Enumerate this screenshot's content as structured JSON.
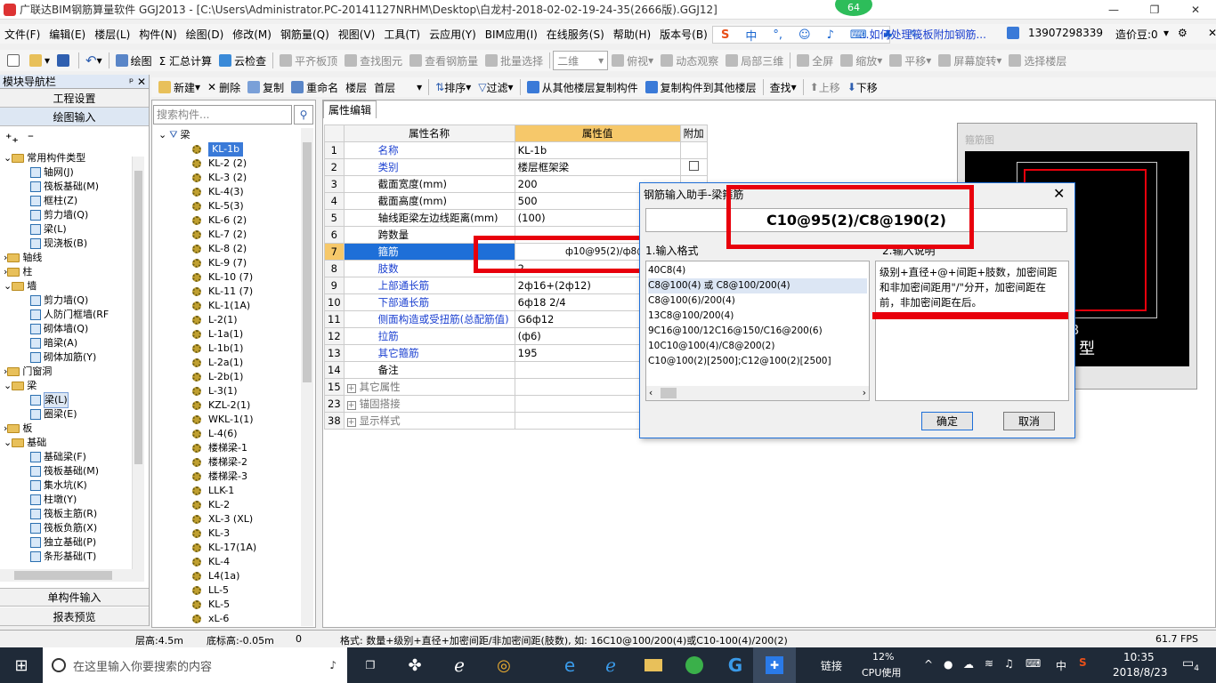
{
  "window": {
    "title": "广联达BIM钢筋算量软件 GGJ2013 - [C:\\Users\\Administrator.PC-20141127NRHM\\Desktop\\白龙村-2018-02-02-19-24-35(2666版).GGJ12]",
    "badge": "64"
  },
  "menu": [
    "文件(F)",
    "编辑(E)",
    "楼层(L)",
    "构件(N)",
    "绘图(D)",
    "修改(M)",
    "钢筋量(Q)",
    "视图(V)",
    "工具(T)",
    "云应用(Y)",
    "BIM应用(I)",
    "在线服务(S)",
    "帮助(H)",
    "版本号(B)"
  ],
  "menu_right": {
    "phone": "13907298339",
    "price": "造价豆:0",
    "notice": "...如何处理筏板附加钢筋..."
  },
  "toolbar": [
    "绘图",
    "Σ 汇总计算",
    "云检查",
    "平齐板顶",
    "查找图元",
    "查看钢筋量",
    "批量选择",
    "二维",
    "俯视",
    "动态观察",
    "局部三维",
    "全屏",
    "缩放",
    "平移",
    "屏幕旋转",
    "选择楼层"
  ],
  "toolbar2": {
    "new": "新建",
    "delete": "删除",
    "copy": "复制",
    "rename": "重命名",
    "floor_label": "楼层",
    "floor_value": "首层",
    "sort": "排序",
    "filter": "过滤",
    "copy_from": "从其他楼层复制构件",
    "copy_to": "复制构件到其他楼层",
    "find": "查找",
    "up": "上移",
    "down": "下移"
  },
  "nav": {
    "title": "模块导航栏",
    "btn_project": "工程设置",
    "btn_draw": "绘图输入",
    "btn_single": "单构件输入",
    "btn_report": "报表预览",
    "tree": [
      "常用构件类型",
      "轴网(J)",
      "筏板基础(M)",
      "框柱(Z)",
      "剪力墙(Q)",
      "梁(L)",
      "现浇板(B)",
      "轴线",
      "柱",
      "墙",
      "剪力墙(Q)",
      "人防门框墙(RF",
      "砌体墙(Q)",
      "暗梁(A)",
      "砌体加筋(Y)",
      "门窗洞",
      "梁",
      "梁(L)",
      "圈梁(E)",
      "板",
      "基础",
      "基础梁(F)",
      "筏板基础(M)",
      "集水坑(K)",
      "柱墩(Y)",
      "筏板主筋(R)",
      "筏板负筋(X)",
      "独立基础(P)",
      "条形基础(T)"
    ]
  },
  "components": {
    "search_placeholder": "搜索构件...",
    "root": "梁",
    "items": [
      "KL-1b",
      "KL-2 (2)",
      "KL-3 (2)",
      "KL-4(3)",
      "KL-5(3)",
      "KL-6 (2)",
      "KL-7 (2)",
      "KL-8 (2)",
      "KL-9 (7)",
      "KL-10 (7)",
      "KL-11 (7)",
      "KL-1(1A)",
      "L-2(1)",
      "L-1a(1)",
      "L-1b(1)",
      "L-2a(1)",
      "L-2b(1)",
      "L-3(1)",
      "KZL-2(1)",
      "WKL-1(1)",
      "L-4(6)",
      "楼梯梁-1",
      "楼梯梁-2",
      "楼梯梁-3",
      "LLK-1",
      "KL-2",
      "XL-3 (XL)",
      "KL-3",
      "KL-17(1A)",
      "KL-4",
      "L4(1a)",
      "LL-5",
      "KL-5",
      "xL-6"
    ]
  },
  "props": {
    "tab": "属性编辑",
    "col_name": "属性名称",
    "col_value": "属性值",
    "col_extra": "附加",
    "rows": [
      {
        "no": "1",
        "name": "名称",
        "value": "KL-1b"
      },
      {
        "no": "2",
        "name": "类别",
        "value": "楼层框架梁"
      },
      {
        "no": "3",
        "name": "截面宽度(mm)",
        "value": "200"
      },
      {
        "no": "4",
        "name": "截面高度(mm)",
        "value": "500"
      },
      {
        "no": "5",
        "name": "轴线距梁左边线距离(mm)",
        "value": "(100)"
      },
      {
        "no": "6",
        "name": "跨数量",
        "value": ""
      },
      {
        "no": "7",
        "name": "箍筋",
        "value": "ф10@95(2)/ф8@190(2)"
      },
      {
        "no": "8",
        "name": "肢数",
        "value": "2"
      },
      {
        "no": "9",
        "name": "上部通长筋",
        "value": "2ф16+(2ф12)"
      },
      {
        "no": "10",
        "name": "下部通长筋",
        "value": "6ф18 2/4"
      },
      {
        "no": "11",
        "name": "侧面构造或受扭筋(总配筋值)",
        "value": "G6ф12"
      },
      {
        "no": "12",
        "name": "拉筋",
        "value": "(ф6)"
      },
      {
        "no": "13",
        "name": "其它箍筋",
        "value": "195"
      },
      {
        "no": "14",
        "name": "备注",
        "value": ""
      },
      {
        "no": "15",
        "name": "其它属性",
        "value": ""
      },
      {
        "no": "23",
        "name": "锚固搭接",
        "value": ""
      },
      {
        "no": "38",
        "name": "显示样式",
        "value": ""
      }
    ]
  },
  "stirrup_preview": {
    "title": "箍筋图",
    "label_b": "B",
    "label_type": "型"
  },
  "dialog": {
    "title": "钢筋输入助手-梁箍筋",
    "input_value": "C10@95(2)/C8@190(2)",
    "format_label": "1.输入格式",
    "desc_label": "2.输入说明",
    "formats": [
      "40C8(4)",
      "C8@100(4) 或 C8@100/200(4)",
      "C8@100(6)/200(4)",
      "13C8@100/200(4)",
      "9C16@100/12C16@150/C16@200(6)",
      "10C10@100(4)/C8@200(2)",
      "C10@100(2)[2500];C12@100(2)[2500]"
    ],
    "description": "级别+直径+@+间距+肢数，加密间距和非加密间距用\"/\"分开，加密间距在前，非加密间距在后。",
    "ok": "确定",
    "cancel": "取消"
  },
  "status": {
    "floor_height": "层高:4.5m",
    "base_height": "底标高:-0.05m",
    "zero": "0",
    "hint": "格式: 数量+级别+直径+加密间距/非加密间距(肢数), 如: 16C10@100/200(4)或C10-100(4)/200(2)",
    "fps": "61.7 FPS"
  },
  "taskbar": {
    "search_placeholder": "在这里输入你要搜索的内容",
    "link": "链接",
    "cpu_percent": "12%",
    "cpu_label": "CPU使用",
    "ime": "中",
    "time": "10:35",
    "date": "2018/8/23",
    "notif": "4"
  }
}
